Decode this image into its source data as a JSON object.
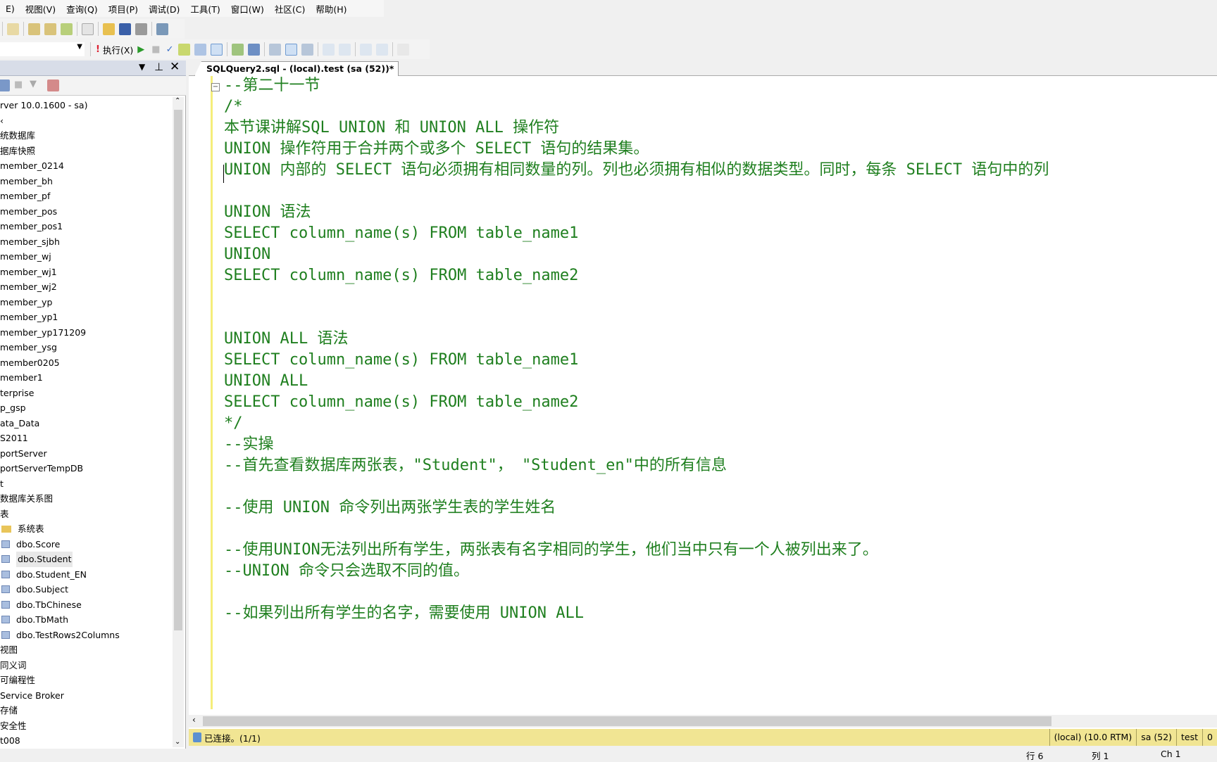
{
  "menu": [
    "E)",
    "视图(V)",
    "查询(Q)",
    "项目(P)",
    "调试(D)",
    "工具(T)",
    "窗口(W)",
    "社区(C)",
    "帮助(H)"
  ],
  "toolbar": {
    "execute_label": "执行(X)"
  },
  "object_explorer": {
    "tree": [
      {
        "label": "rver 10.0.1600 - sa)",
        "type": "text"
      },
      {
        "label": "‹",
        "type": "text"
      },
      {
        "label": "统数据库",
        "type": "text"
      },
      {
        "label": "据库快照",
        "type": "text"
      },
      {
        "label": "member_0214",
        "type": "text"
      },
      {
        "label": "member_bh",
        "type": "text"
      },
      {
        "label": "member_pf",
        "type": "text"
      },
      {
        "label": "member_pos",
        "type": "text"
      },
      {
        "label": "member_pos1",
        "type": "text"
      },
      {
        "label": "member_sjbh",
        "type": "text"
      },
      {
        "label": "member_wj",
        "type": "text"
      },
      {
        "label": "member_wj1",
        "type": "text"
      },
      {
        "label": "member_wj2",
        "type": "text"
      },
      {
        "label": "member_yp",
        "type": "text"
      },
      {
        "label": "member_yp1",
        "type": "text"
      },
      {
        "label": "member_yp171209",
        "type": "text"
      },
      {
        "label": "member_ysg",
        "type": "text"
      },
      {
        "label": "member0205",
        "type": "text"
      },
      {
        "label": "member1",
        "type": "text"
      },
      {
        "label": "terprise",
        "type": "text"
      },
      {
        "label": "p_gsp",
        "type": "text"
      },
      {
        "label": "ata_Data",
        "type": "text"
      },
      {
        "label": "S2011",
        "type": "text"
      },
      {
        "label": "portServer",
        "type": "text"
      },
      {
        "label": "portServerTempDB",
        "type": "text"
      },
      {
        "label": "t",
        "type": "text"
      },
      {
        "label": " 数据库关系图",
        "type": "text"
      },
      {
        "label": " 表",
        "type": "text"
      },
      {
        "label": "系统表",
        "type": "folder"
      },
      {
        "label": "dbo.Score",
        "type": "table"
      },
      {
        "label": "dbo.Student",
        "type": "table",
        "selected": true
      },
      {
        "label": "dbo.Student_EN",
        "type": "table"
      },
      {
        "label": "dbo.Subject",
        "type": "table"
      },
      {
        "label": "dbo.TbChinese",
        "type": "table"
      },
      {
        "label": "dbo.TbMath",
        "type": "table"
      },
      {
        "label": "dbo.TestRows2Columns",
        "type": "table"
      },
      {
        "label": " 视图",
        "type": "text"
      },
      {
        "label": " 同义词",
        "type": "text"
      },
      {
        "label": " 可编程性",
        "type": "text"
      },
      {
        "label": " Service Broker",
        "type": "text"
      },
      {
        "label": " 存储",
        "type": "text"
      },
      {
        "label": " 安全性",
        "type": "text"
      },
      {
        "label": "t008",
        "type": "text"
      }
    ]
  },
  "editor": {
    "tab_title": "SQLQuery2.sql - (local).test (sa (52))*",
    "lines": [
      "--第二十一节",
      "/*",
      "本节课讲解SQL UNION 和 UNION ALL 操作符",
      "UNION 操作符用于合并两个或多个 SELECT 语句的结果集。",
      "UNION 内部的 SELECT 语句必须拥有相同数量的列。列也必须拥有相似的数据类型。同时，每条 SELECT 语句中的列",
      "",
      "UNION 语法",
      "SELECT column_name(s) FROM table_name1",
      "UNION",
      "SELECT column_name(s) FROM table_name2",
      "",
      "",
      "UNION ALL 语法",
      "SELECT column_name(s) FROM table_name1",
      "UNION ALL",
      "SELECT column_name(s) FROM table_name2",
      "*/",
      "--实操",
      "--首先查看数据库两张表，\"Student\"， \"Student_en\"中的所有信息",
      "",
      "--使用 UNION 命令列出两张学生表的学生姓名",
      "",
      "--使用UNION无法列出所有学生，两张表有名字相同的学生，他们当中只有一个人被列出来了。",
      "--UNION 命令只会选取不同的值。",
      "",
      "--如果列出所有学生的名字，需要使用 UNION ALL"
    ],
    "comment_color": "#1f7f1f"
  },
  "status": {
    "connection": "已连接。(1/1)",
    "server": "(local) (10.0 RTM)",
    "user": "sa (52)",
    "database": "test",
    "extra": "0"
  },
  "bottom": {
    "row": "行 6",
    "col": "列 1",
    "ch": "Ch 1"
  }
}
